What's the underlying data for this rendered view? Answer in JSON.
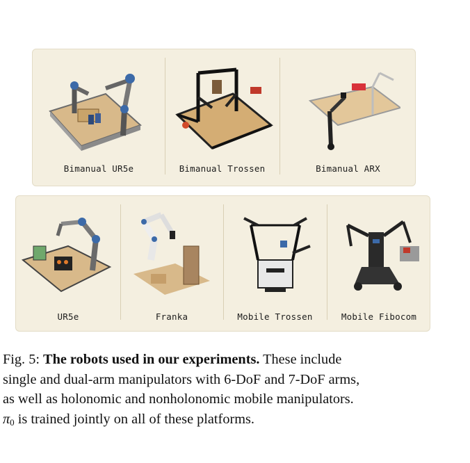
{
  "figure": {
    "top_row": [
      {
        "label": "Bimanual UR5e",
        "image": "bimanual-ur5e-robot"
      },
      {
        "label": "Bimanual Trossen",
        "image": "bimanual-trossen-robot"
      },
      {
        "label": "Bimanual ARX",
        "image": "bimanual-arx-robot"
      }
    ],
    "bottom_row": [
      {
        "label": "UR5e",
        "image": "ur5e-robot"
      },
      {
        "label": "Franka",
        "image": "franka-robot"
      },
      {
        "label": "Mobile Trossen",
        "image": "mobile-trossen-robot"
      },
      {
        "label": "Mobile Fibocom",
        "image": "mobile-fibocom-robot"
      }
    ],
    "colors": {
      "panel_background": "#f4efe0",
      "panel_border": "#e3dcc6",
      "divider": "#d9cfb4"
    }
  },
  "caption": {
    "prefix": "Fig. 5: ",
    "title": "The robots used in our experiments.",
    "text_line1": " These include",
    "text_line2": "single and dual-arm manipulators with 6-DoF and 7-DoF arms,",
    "text_line3": "as well as holonomic and nonholonomic mobile manipulators.",
    "pi_symbol": "π",
    "pi_subscript": "0",
    "text_line4": " is trained jointly on all of these platforms."
  }
}
